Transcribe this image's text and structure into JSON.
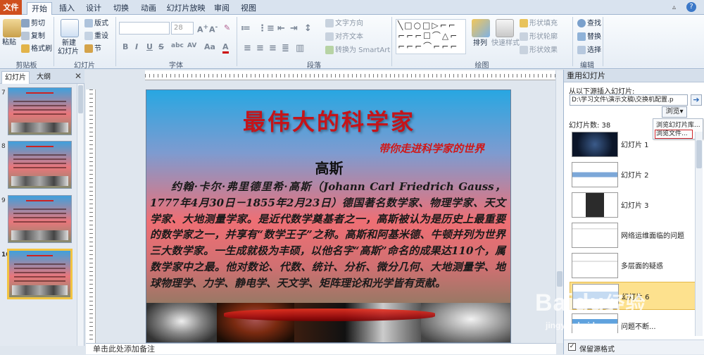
{
  "tabs": [
    "文件",
    "开始",
    "插入",
    "设计",
    "切换",
    "动画",
    "幻灯片放映",
    "审阅",
    "视图"
  ],
  "ribbon": {
    "clipboard": {
      "paste": "粘贴",
      "cut": "剪切",
      "copy": "复制",
      "format_painter": "格式刷",
      "label": "剪贴板"
    },
    "slides": {
      "new_slide": "新建",
      "new_slide2": "幻灯片",
      "layout": "版式",
      "reset": "重设",
      "section": "节",
      "label": "幻灯片"
    },
    "font": {
      "size": "28",
      "label": "字体",
      "bold": "B",
      "italic": "I",
      "underline": "U",
      "strike": "S",
      "shadow": "abc",
      "spacing": "AV",
      "case": "Aa",
      "color": "A"
    },
    "paragraph": {
      "text_direction": "文字方向",
      "align_text": "对齐文本",
      "smartart": "转换为 SmartArt",
      "label": "段落"
    },
    "drawing": {
      "arrange": "排列",
      "quick_styles": "快速样式",
      "fill": "形状填充",
      "outline": "形状轮廓",
      "effects": "形状效果",
      "label": "绘图"
    },
    "editing": {
      "find": "查找",
      "replace": "替换",
      "select": "选择",
      "label": "编辑"
    }
  },
  "left_panel": {
    "tab_slides": "幻灯片",
    "tab_outline": "大纲",
    "thumbs": [
      {
        "num": "7"
      },
      {
        "num": "8"
      },
      {
        "num": "9"
      },
      {
        "num": "10",
        "selected": true
      }
    ]
  },
  "slide": {
    "title": "最伟大的科学家",
    "subtitle": "带你走进科学家的世界",
    "heading": "高斯",
    "body": "约翰·卡尔·弗里德里希·高斯（Johann Carl Friedrich Gauss，1777年4月30日－1855年2月23日）德国著名数学家、物理学家、天文学家、大地测量学家。是近代数学奠基者之一，高斯被认为是历史上最重要的数学家之一，并享有“数学王子”之称。高斯和阿基米德、牛顿并列为世界三大数学家。一生成就极为丰硕，以他名字“高斯”命名的成果达110个，属数学家中之最。他对数论、代数、统计、分析、微分几何、大地测量学、地球物理学、力学、静电学、天文学、矩阵理论和光学皆有贡献。"
  },
  "notes": "单击此处添加备注",
  "right_panel": {
    "title": "重用幻灯片",
    "insert_from": "从以下源插入幻灯片:",
    "path": "D:\\学习文件\\演示文稿\\交换机配置.p",
    "browse": "浏览",
    "slide_count": "幻灯片数: 38",
    "menu": [
      "浏览幻灯片库...",
      "浏览文件..."
    ],
    "items": [
      {
        "label": "幻灯片 1"
      },
      {
        "label": "幻灯片 2"
      },
      {
        "label": "幻灯片 3"
      },
      {
        "label": "网络运维面临的问题"
      },
      {
        "label": "多层面的疑惑"
      },
      {
        "label": "幻灯片 6"
      },
      {
        "label": "问题不断..."
      }
    ],
    "keep_format": "保留源格式"
  },
  "watermark": {
    "brand": "Baidu",
    "brand_cn": "经验",
    "url": "jingyan.baidu.com"
  }
}
